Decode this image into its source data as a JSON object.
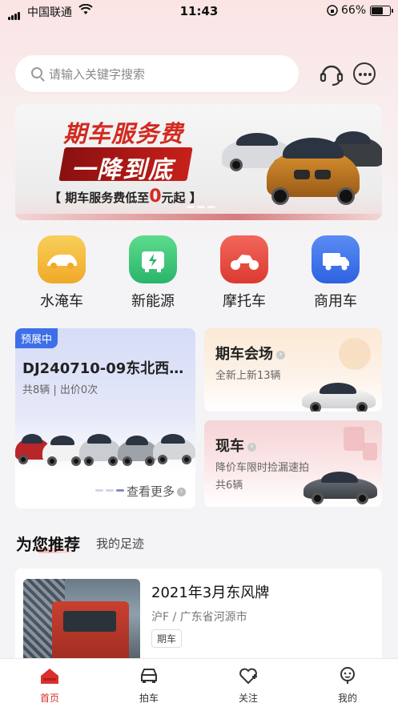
{
  "status_bar": {
    "carrier": "中国联通",
    "time": "11:43",
    "battery": "66%",
    "battery_level": 0.66
  },
  "search": {
    "placeholder": "请输入关键字搜索"
  },
  "header_icons": [
    "customer-service-icon",
    "message-icon"
  ],
  "banner": {
    "line1": "期车服务费",
    "line2": "一降到底",
    "line3_prefix": "【 期车服务费低至",
    "line3_value": "0",
    "line3_suffix": "元起 】"
  },
  "categories": [
    {
      "label": "水淹车",
      "icon": "flooded-car-icon",
      "color": "#f2b632"
    },
    {
      "label": "新能源",
      "icon": "new-energy-icon",
      "color": "#3ec97a"
    },
    {
      "label": "摩托车",
      "icon": "motorcycle-icon",
      "color": "#e8473c"
    },
    {
      "label": "商用车",
      "icon": "truck-icon",
      "color": "#3f72e9"
    }
  ],
  "preview_card": {
    "tag": "预展中",
    "title": "DJ240710-09东北西…",
    "meta": "共8辆 | 出价0次",
    "more": "查看更多"
  },
  "futures_card": {
    "title": "期车会场",
    "subtitle": "全新上新13辆"
  },
  "spot_card": {
    "title": "现车",
    "subtitle": "降价车限时捡漏速拍",
    "count": "共6辆"
  },
  "recommend": {
    "tab_active": "为您推荐",
    "tab_other": "我的足迹",
    "item": {
      "title": "2021年3月东风牌",
      "location": "沪F / 广东省河源市",
      "chip": "期车"
    }
  },
  "tabbar": [
    {
      "label": "首页",
      "icon": "home-icon"
    },
    {
      "label": "拍车",
      "icon": "car-icon"
    },
    {
      "label": "关注",
      "icon": "heart-icon"
    },
    {
      "label": "我的",
      "icon": "profile-icon"
    }
  ],
  "colors": {
    "accent": "#d7322b",
    "preview_tag": "#3f6fe8"
  }
}
